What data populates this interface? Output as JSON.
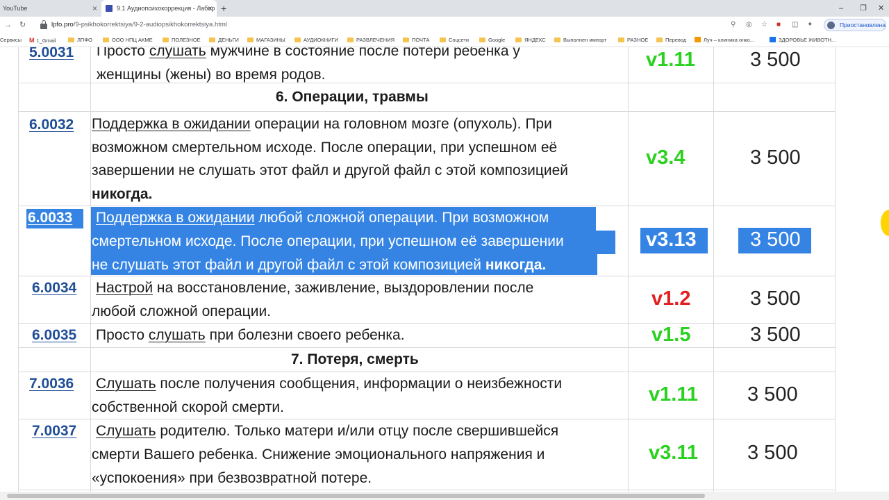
{
  "browser": {
    "tabs": [
      {
        "title": "YouTube"
      },
      {
        "title": "9.1 Аудиопсихокоррекция - Лабор"
      }
    ],
    "url_host": "lpfo.pro",
    "url_path": "/9-psikhokorrektsiya/9-2-audiopsikhokorrektsiya.html",
    "profile_status": "Приостановлена",
    "bookmarks": [
      "Сервисы",
      "1_Gmail",
      "ЛПФО",
      "ООО НПЦ АКМЕ",
      "ПОЛЕЗНОЕ",
      "ДЕНЬГИ",
      "МАГАЗИНЫ",
      "АУДИОКНИГИ",
      "РАЗВЛЕЧЕНИЯ",
      "ПОЧТА",
      "Соцсети",
      "Google",
      "ЯНДЕКС",
      "Выполнен импорт",
      "РАЗНОЕ",
      "Перевод",
      "Луч – клиника онко...",
      "ЗДОРОВЬЕ ЖИВОТН..."
    ]
  },
  "table": {
    "top_row": {
      "code": "5.0031",
      "line1_pre": "Просто ",
      "line1_link": "слушать",
      "line1_post": " мужчине в состояние после потери ребенка у",
      "line2": "женщины (жены) во время родов.",
      "version": "v1.11",
      "price": "3 500"
    },
    "section6": "6. Операции, травмы",
    "row_6_0032": {
      "code": "6.0032",
      "link": "Поддержка в ожидании",
      "l1": " операции на головном мозге (опухоль). При",
      "l2": "возможном смертельном исходе. После операции, при успешном её",
      "l3": "завершении не слушать этот файл и другой файл с этой композицией",
      "l4": "никогда.",
      "version": "v3.4",
      "price": "3 500"
    },
    "row_6_0033": {
      "code": "6.0033",
      "link": "Поддержка в ожидании",
      "l1": " любой сложной операции. При возможном",
      "l2": "смертельном исходе. После операции, при успешном её завершении",
      "l3": "не слушать этот файл и другой файл с этой композицией ",
      "l3b": "никогда.",
      "version": "v3.13",
      "price": "3 500"
    },
    "row_6_0034": {
      "code": "6.0034",
      "link": "Настрой",
      "l1": " на восстановление, заживление, выздоровлении после",
      "l2": "любой сложной операции.",
      "version": "v1.2",
      "price": "3 500"
    },
    "row_6_0035": {
      "code": "6.0035",
      "pre": "Просто ",
      "link": "слушать",
      "l1": " при болезни своего ребенка.",
      "version": "v1.5",
      "price": "3 500"
    },
    "section7": "7. Потеря, смерть",
    "row_7_0036": {
      "code": "7.0036",
      "link": "Слушать",
      "l1": " после получения сообщения, информации о неизбежности",
      "l2": "собственной скорой смерти.",
      "version": "v1.11",
      "price": "3 500"
    },
    "row_7_0037": {
      "code": "7.0037",
      "link": "Слушать",
      "l1": " родителю. Только матери и/или отцу после свершившейся",
      "l2": "смерти Вашего ребенка. Снижение эмоционального напряжения и",
      "l3": "«успокоения» при безвозвратной потере.",
      "version": "v3.11",
      "price": "3 500"
    }
  },
  "colors": {
    "version_green": "#2ad11f",
    "version_red": "#e31e1e",
    "selection": "#3584e4",
    "code_link": "#1f4e96"
  }
}
